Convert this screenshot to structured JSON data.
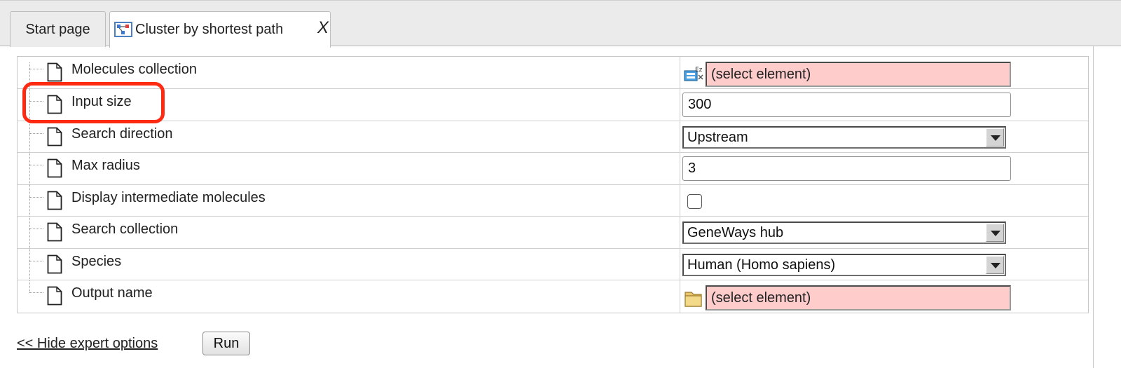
{
  "tabs": {
    "start": "Start page",
    "active": "Cluster by shortest path",
    "close": "X"
  },
  "params": [
    {
      "label": "Molecules collection",
      "control": "element",
      "value": "(select element)",
      "icon": "data-collection-icon"
    },
    {
      "label": "Input size",
      "control": "text",
      "value": "300"
    },
    {
      "label": "Search direction",
      "control": "select",
      "value": "Upstream"
    },
    {
      "label": "Max radius",
      "control": "text",
      "value": "3"
    },
    {
      "label": "Display intermediate molecules",
      "control": "checkbox",
      "checked": false
    },
    {
      "label": "Search collection",
      "control": "select",
      "value": "GeneWays hub"
    },
    {
      "label": "Species",
      "control": "select",
      "value": "Human (Homo sapiens)"
    },
    {
      "label": "Output name",
      "control": "element",
      "value": "(select element)",
      "icon": "folder-icon"
    }
  ],
  "footer": {
    "hide_link": "<< Hide expert options",
    "run": "Run"
  },
  "colors": {
    "required_field": "#ffcccc",
    "highlight": "#ff2a12"
  }
}
